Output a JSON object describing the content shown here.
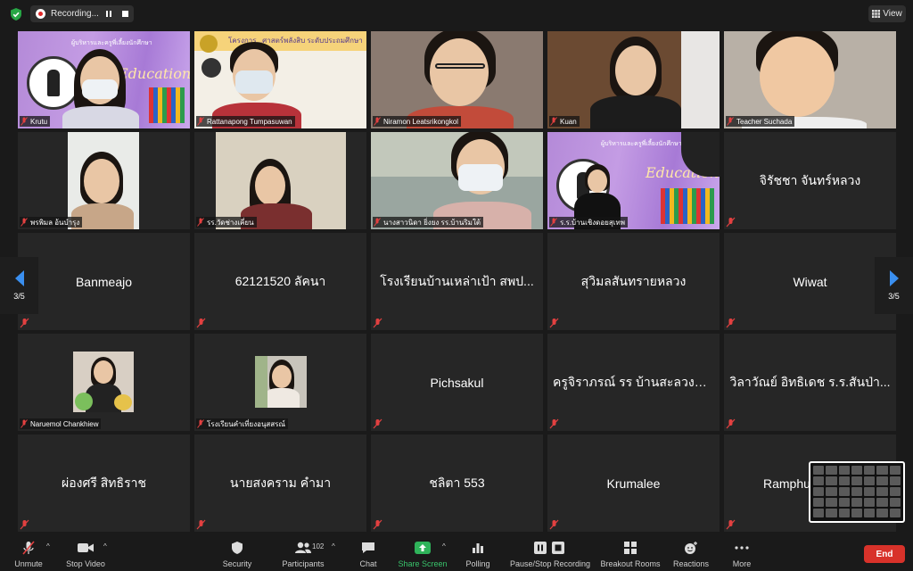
{
  "top": {
    "recording_label": "Recording...",
    "view_label": "View"
  },
  "tiles": [
    {
      "name": "Krutu",
      "type": "video"
    },
    {
      "name": "Rattanapong Tumpasuwan",
      "type": "video"
    },
    {
      "name": "Niramon Leatsrikongkol",
      "type": "video"
    },
    {
      "name": "Kuan",
      "type": "video"
    },
    {
      "name": "Teacher Suchada",
      "type": "video"
    },
    {
      "name": "พรพิมล อ้นบำรุง",
      "type": "video"
    },
    {
      "name": "รร.วัดช่างเคี่ยน",
      "type": "video"
    },
    {
      "name": "นางสาวนิดา ยิ่งยง รร.บ้านริมใต้",
      "type": "video"
    },
    {
      "name": "ร.ร.บ้านเชิงดอยสุเทพ",
      "type": "video"
    },
    {
      "name": "จิรัชชา จันทร์หลวง",
      "type": "name"
    },
    {
      "name": "Banmeajo",
      "type": "name"
    },
    {
      "name": "62121520 ลัคนา",
      "type": "name"
    },
    {
      "name": "โรงเรียนบ้านเหล่าเป้า สพป...",
      "type": "name"
    },
    {
      "name": "สุวิมลสันทรายหลวง",
      "type": "name"
    },
    {
      "name": "Wiwat",
      "type": "name"
    },
    {
      "name": "Naruemol Chankhiew",
      "type": "photo"
    },
    {
      "name": "โรงเรียนคำเที่ยงอนุสสรณ์",
      "type": "photo"
    },
    {
      "name": "Pichsakul",
      "type": "name"
    },
    {
      "name": "ครูจิราภรณ์ รร บ้านสะลวงนอก",
      "type": "name"
    },
    {
      "name": "วิลาวัณย์ อิทธิเดช ร.ร.สันป่า...",
      "type": "name"
    },
    {
      "name": "ผ่องศรี สิทธิราช",
      "type": "name"
    },
    {
      "name": "นายสงคราม คำมา",
      "type": "name"
    },
    {
      "name": "ชลิตา 553",
      "type": "name"
    },
    {
      "name": "Krumalee",
      "type": "name"
    },
    {
      "name": "Ramphu",
      "type": "name"
    }
  ],
  "banner": {
    "title_top": "ผู้บริหารและครูพี่เลี้ยงนักศึกษา",
    "script_word": "Elementary Education",
    "project_title": "โครงการ...ศาสตร์พลังสิบ ระดับประถมศึกษา"
  },
  "pager": {
    "left": "3/5",
    "right": "3/5"
  },
  "toolbar": {
    "unmute": "Unmute",
    "stop_video": "Stop Video",
    "security": "Security",
    "participants": "Participants",
    "participants_count": "102",
    "chat": "Chat",
    "share_screen": "Share Screen",
    "polling": "Polling",
    "pause_stop_recording": "Pause/Stop Recording",
    "breakout_rooms": "Breakout Rooms",
    "reactions": "Reactions",
    "more": "More",
    "end": "End"
  },
  "colors": {
    "accent_blue": "#3a8ff0",
    "share_green": "#2fb35a",
    "end_red": "#d8322a",
    "tile_bg": "#262626"
  }
}
